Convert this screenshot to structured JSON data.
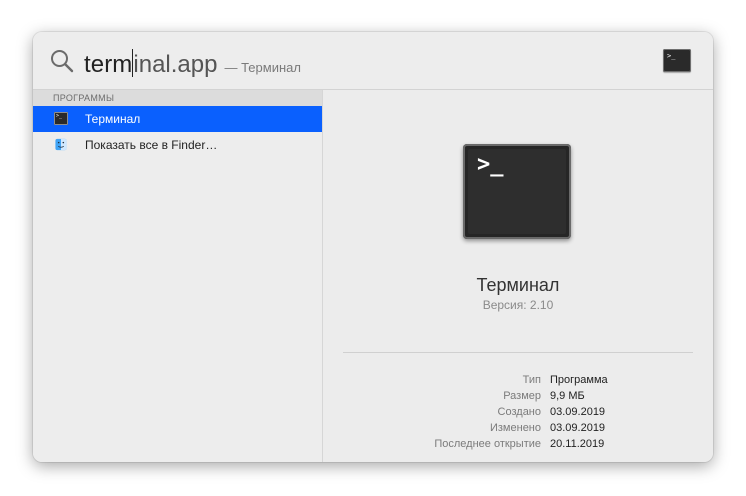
{
  "search": {
    "typed_before_caret": "term",
    "typed_after_caret": "inal.app",
    "hint": "— Терминал"
  },
  "top_icon": {
    "glyph": ">_"
  },
  "results": {
    "section_title": "ПРОГРАММЫ",
    "items": [
      {
        "label": "Терминал",
        "icon": "terminal-icon",
        "selected": true
      },
      {
        "label": "Показать все в Finder…",
        "icon": "finder-icon",
        "selected": false
      }
    ]
  },
  "preview": {
    "icon_glyph": ">_",
    "app_name": "Терминал",
    "version": "Версия: 2.10",
    "meta": [
      {
        "key": "Тип",
        "value": "Программа"
      },
      {
        "key": "Размер",
        "value": "9,9 МБ"
      },
      {
        "key": "Создано",
        "value": "03.09.2019"
      },
      {
        "key": "Изменено",
        "value": "03.09.2019"
      },
      {
        "key": "Последнее открытие",
        "value": "20.11.2019"
      }
    ]
  },
  "colors": {
    "selection": "#0a60fe",
    "window_bg": "#ececec"
  }
}
